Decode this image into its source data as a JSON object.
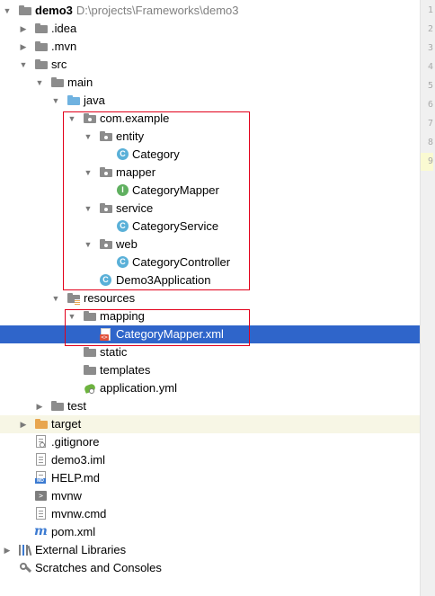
{
  "project_tree": {
    "root_name": "demo3",
    "root_path": "D:\\projects\\Frameworks\\demo3",
    "idea": ".idea",
    "mvn": ".mvn",
    "src": "src",
    "main": "main",
    "java": "java",
    "com_example": "com.example",
    "entity": "entity",
    "category": "Category",
    "mapper": "mapper",
    "category_mapper": "CategoryMapper",
    "service": "service",
    "category_service": "CategoryService",
    "web": "web",
    "category_controller": "CategoryController",
    "demo3_application": "Demo3Application",
    "resources": "resources",
    "mapping": "mapping",
    "category_mapper_xml": "CategoryMapper.xml",
    "static": "static",
    "templates": "templates",
    "application_yml": "application.yml",
    "test": "test",
    "target": "target",
    "gitignore": ".gitignore",
    "demo3_iml": "demo3.iml",
    "help_md": "HELP.md",
    "mvnw": "mvnw",
    "mvnw_cmd": "mvnw.cmd",
    "pom_xml": "pom.xml",
    "external_libraries": "External Libraries",
    "scratches": "Scratches and Consoles",
    "selected_item": "CategoryMapper.xml"
  },
  "gutter": {
    "line_numbers": [
      "1",
      "2",
      "3",
      "4",
      "5",
      "6",
      "7",
      "8",
      "9"
    ]
  },
  "colors": {
    "selection": "#2f65ca",
    "highlight": "#f7f6e5",
    "annotation_box": "#e2001a",
    "folder_gray": "#8c8c8c",
    "source_folder_blue": "#6fb2e0",
    "excluded_orange": "#e8a64f",
    "class_icon": "#5ab0d8",
    "interface_icon": "#60b060"
  }
}
